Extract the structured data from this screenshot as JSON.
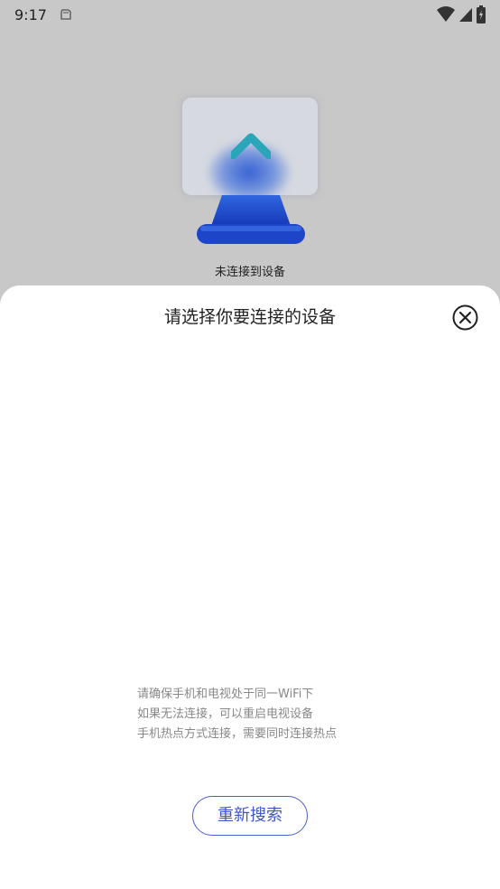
{
  "status_bar": {
    "time": "9:17",
    "icons": [
      "sd-card-icon",
      "wifi-icon",
      "signal-icon",
      "battery-icon"
    ]
  },
  "background": {
    "connection_status": "未连接到设备",
    "illustration": "tv-icon",
    "accent_color": "#2f5bd4"
  },
  "sheet": {
    "title": "请选择你要连接的设备",
    "close_icon": "close-circle-icon",
    "hints": [
      "请确保手机和电视处于同一WiFi下",
      "如果无法连接，可以重启电视设备",
      "手机热点方式连接，需要同时连接热点"
    ],
    "rescan_label": "重新搜索",
    "button_color": "#3f56cc"
  }
}
